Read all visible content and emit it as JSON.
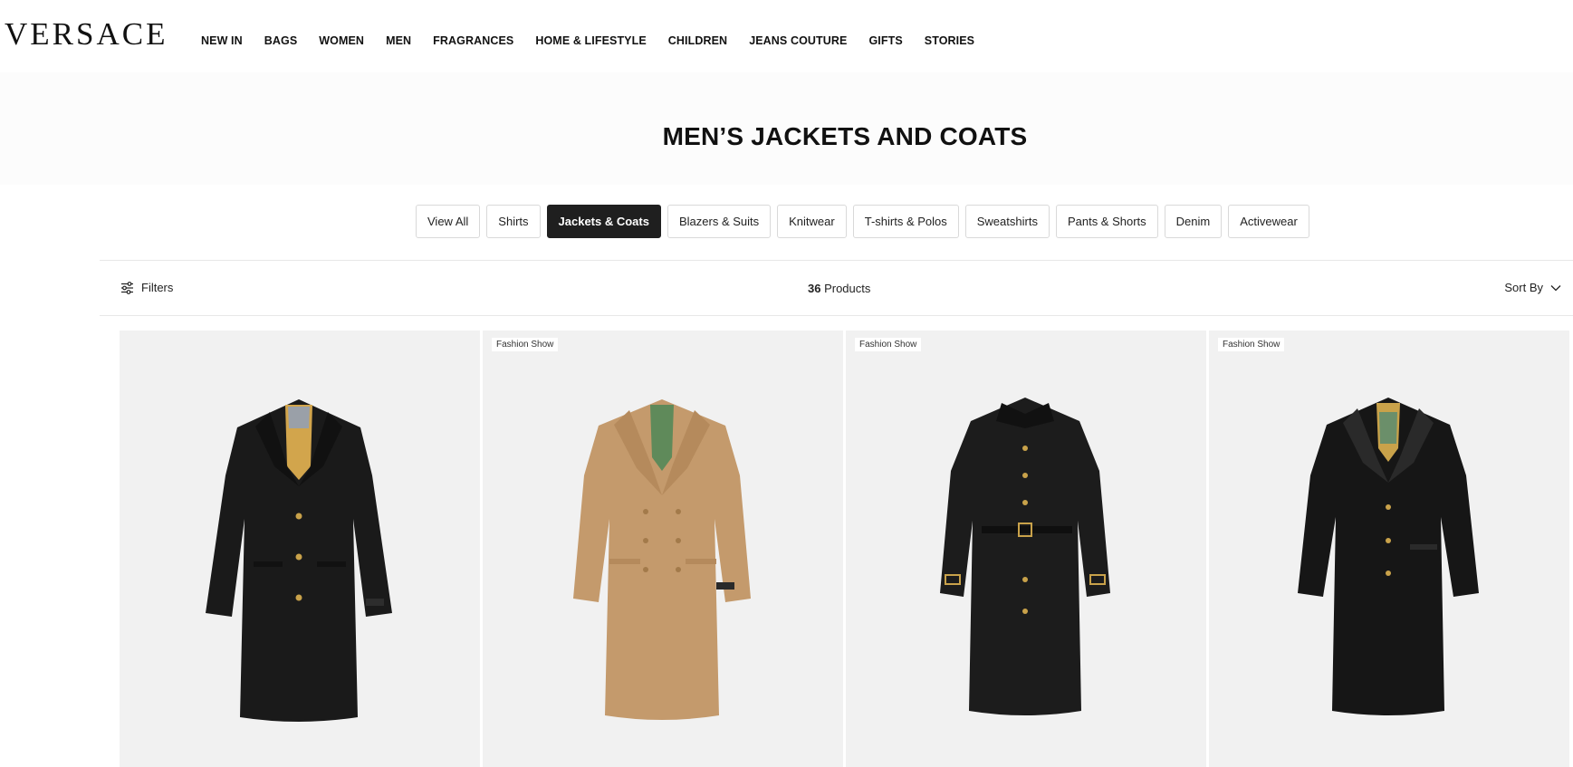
{
  "brand": {
    "logo_text": "VERSACE"
  },
  "nav": [
    {
      "label": "NEW IN"
    },
    {
      "label": "BAGS"
    },
    {
      "label": "WOMEN"
    },
    {
      "label": "MEN"
    },
    {
      "label": "FRAGRANCES"
    },
    {
      "label": "HOME & LIFESTYLE"
    },
    {
      "label": "CHILDREN"
    },
    {
      "label": "JEANS COUTURE"
    },
    {
      "label": "GIFTS"
    },
    {
      "label": "STORIES"
    }
  ],
  "page": {
    "title": "MEN’S JACKETS AND COATS"
  },
  "categories": [
    {
      "label": "View All",
      "active": false
    },
    {
      "label": "Shirts",
      "active": false
    },
    {
      "label": "Jackets & Coats",
      "active": true
    },
    {
      "label": "Blazers & Suits",
      "active": false
    },
    {
      "label": "Knitwear",
      "active": false
    },
    {
      "label": "T-shirts & Polos",
      "active": false
    },
    {
      "label": "Sweatshirts",
      "active": false
    },
    {
      "label": "Pants & Shorts",
      "active": false
    },
    {
      "label": "Denim",
      "active": false
    },
    {
      "label": "Activewear",
      "active": false
    }
  ],
  "toolbar": {
    "filters_label": "Filters",
    "filters_icon": "sliders-icon",
    "product_count": "36",
    "product_count_suffix": " Products",
    "sort_label": "Sort By",
    "sort_icon": "chevron-down-icon"
  },
  "products": [
    {
      "badge": "",
      "image": "black-wool-coat",
      "coat_color": "#1a1a1a"
    },
    {
      "badge": "Fashion Show",
      "image": "camel-double-breasted-coat",
      "coat_color": "#c49a6c"
    },
    {
      "badge": "Fashion Show",
      "image": "black-belted-trench-coat",
      "coat_color": "#1c1c1c"
    },
    {
      "badge": "Fashion Show",
      "image": "black-leather-coat",
      "coat_color": "#161616"
    }
  ],
  "colors": {
    "accent_dark": "#1f1f1f",
    "card_bg": "#f1f1f1",
    "gold": "#c9a24a"
  }
}
